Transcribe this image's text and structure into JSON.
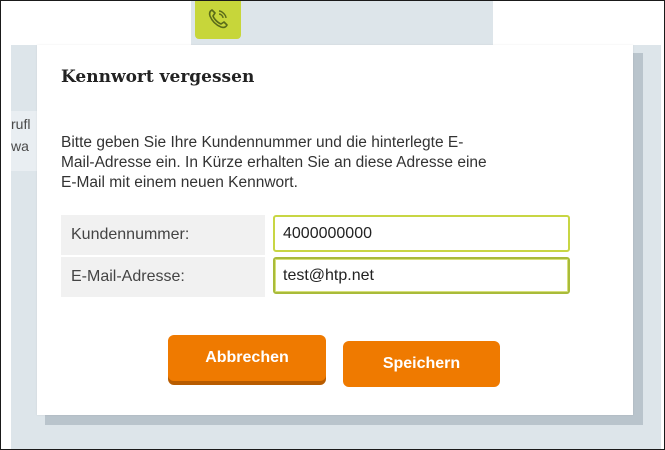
{
  "background": {
    "fragment_1": "rufl",
    "fragment_2": "wa"
  },
  "dialog": {
    "title": "Kennwort vergessen",
    "description_line_1": "Bitte geben Sie Ihre Kundennummer und die hinterlegte E-",
    "description_line_2": "Mail-Adresse ein. In Kürze erhalten Sie an diese Adresse eine",
    "description_line_3": "E-Mail mit einem neuen Kennwort.",
    "fields": {
      "customer_number": {
        "label": "Kundennummer:",
        "value": "4000000000"
      },
      "email": {
        "label": "E-Mail-Adresse:",
        "value": "test@htp.net"
      }
    },
    "buttons": {
      "cancel": "Abbrechen",
      "save": "Speichern"
    }
  },
  "icons": {
    "top_tile": "phone-icon"
  },
  "colors": {
    "accent_orange": "#ef7a00",
    "accent_lime": "#c8d644"
  }
}
